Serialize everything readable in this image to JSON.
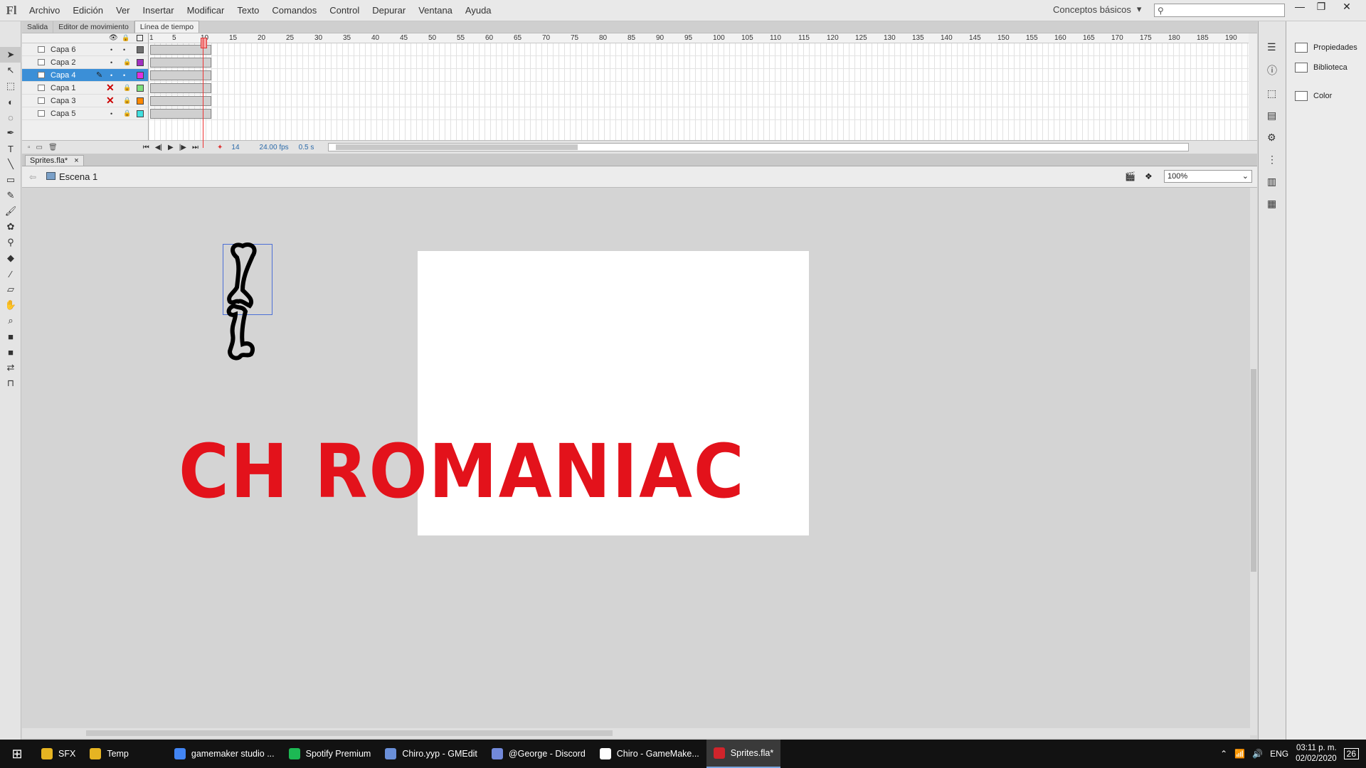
{
  "app": {
    "logo": "Fl"
  },
  "menu": [
    "Archivo",
    "Edición",
    "Ver",
    "Insertar",
    "Modificar",
    "Texto",
    "Comandos",
    "Control",
    "Depurar",
    "Ventana",
    "Ayuda"
  ],
  "workspace": {
    "label": "Conceptos básicos",
    "arrow": "▾"
  },
  "search": {
    "icon": "⚲"
  },
  "window_controls": {
    "minimize": "—",
    "restore": "❐",
    "close": "✕"
  },
  "panel_tabs": [
    "Salida",
    "Editor de movimiento",
    "Línea de tiempo"
  ],
  "timeline": {
    "layers": [
      {
        "name": "Capa 6",
        "eye": "•",
        "lock": "•",
        "color": "#707070",
        "hidden": false,
        "selected": false,
        "frames": 9
      },
      {
        "name": "Capa 2",
        "eye": "•",
        "lock": "🔒",
        "color": "#a030c0",
        "hidden": false,
        "selected": false,
        "frames": 9
      },
      {
        "name": "Capa 4",
        "eye": "•",
        "lock": "•",
        "color": "#e030e0",
        "hidden": false,
        "selected": true,
        "frames": 9
      },
      {
        "name": "Capa 1",
        "eye": "✕",
        "lock": "🔒",
        "color": "#7ee07e",
        "hidden": true,
        "selected": false,
        "frames": 9
      },
      {
        "name": "Capa 3",
        "eye": "✕",
        "lock": "🔒",
        "color": "#ff8800",
        "hidden": true,
        "selected": false,
        "frames": 9
      },
      {
        "name": "Capa 5",
        "eye": "•",
        "lock": "🔒",
        "color": "#40e0e0",
        "hidden": false,
        "selected": false,
        "frames": 9
      }
    ],
    "ruler": [
      "1",
      "5",
      "10",
      "15",
      "20",
      "25",
      "30",
      "35",
      "40",
      "45",
      "50",
      "55",
      "60",
      "65",
      "70",
      "75",
      "80",
      "85",
      "90",
      "95",
      "100",
      "105",
      "110",
      "115",
      "120",
      "125",
      "130",
      "135",
      "140",
      "145",
      "150",
      "155",
      "160",
      "165",
      "170",
      "175",
      "180",
      "185",
      "190"
    ],
    "frame": "14",
    "fps": "24.00 fps",
    "time": "0.5 s",
    "controls": [
      "⏮",
      "◀|",
      "▶",
      "|▶",
      "⏭"
    ]
  },
  "document": {
    "tab": "Sprites.fla*",
    "close": "×",
    "scene": "Escena 1",
    "zoom": "100%"
  },
  "stage_text": "CH ROMANIAC",
  "right_panel": [
    "Propiedades",
    "Biblioteca",
    "Color"
  ],
  "taskbar": {
    "items": [
      {
        "label": "SFX",
        "color": "#e6b422",
        "active": false
      },
      {
        "label": "Temp",
        "color": "#e6b422",
        "active": false
      },
      {
        "label": "gamemaker studio ...",
        "color": "#4285f4",
        "active": false
      },
      {
        "label": "Spotify Premium",
        "color": "#1db954",
        "active": false
      },
      {
        "label": "Chiro.yyp - GMEdit",
        "color": "#6a8fd8",
        "active": false
      },
      {
        "label": "@George - Discord",
        "color": "#7289da",
        "active": false
      },
      {
        "label": "Chiro - GameMake...",
        "color": "#ffffff",
        "active": false
      },
      {
        "label": "Sprites.fla*",
        "color": "#d0242b",
        "active": true
      }
    ],
    "lang": "ENG",
    "time": "03:11 p. m.",
    "date": "02/02/2020",
    "notifications": "26"
  }
}
